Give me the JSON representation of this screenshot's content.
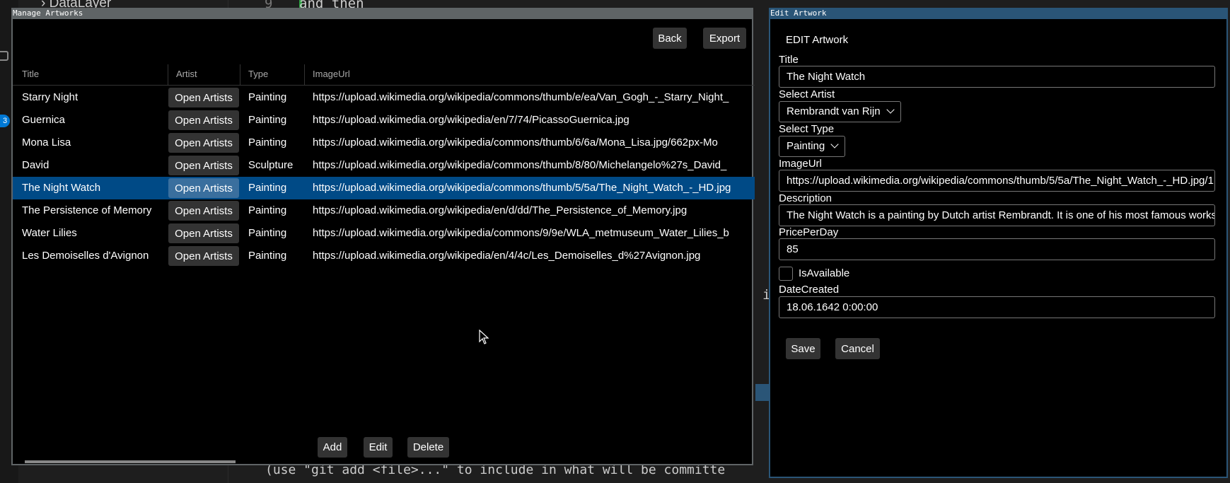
{
  "ide": {
    "explorer_item": "DataLayer",
    "line_number": "9",
    "code_text": "and then",
    "stray_char": "i",
    "terminal_text": "(use \"git add <file>...\" to include in what will be committe",
    "badge": "3"
  },
  "manage": {
    "window_title": "Manage Artworks",
    "back_label": "Back",
    "export_label": "Export",
    "columns": [
      "Title",
      "Artist",
      "Type",
      "ImageUrl"
    ],
    "open_artists_label": "Open Artists",
    "rows": [
      {
        "title": "Starry Night",
        "type": "Painting",
        "url": "https://upload.wikimedia.org/wikipedia/commons/thumb/e/ea/Van_Gogh_-_Starry_Night_"
      },
      {
        "title": "Guernica",
        "type": "Painting",
        "url": "https://upload.wikimedia.org/wikipedia/en/7/74/PicassoGuernica.jpg"
      },
      {
        "title": "Mona Lisa",
        "type": "Painting",
        "url": "https://upload.wikimedia.org/wikipedia/commons/thumb/6/6a/Mona_Lisa.jpg/662px-Mo"
      },
      {
        "title": "David",
        "type": "Sculpture",
        "url": "https://upload.wikimedia.org/wikipedia/commons/thumb/8/80/Michelangelo%27s_David_"
      },
      {
        "title": "The Night Watch",
        "type": "Painting",
        "url": "https://upload.wikimedia.org/wikipedia/commons/thumb/5/5a/The_Night_Watch_-_HD.jpg",
        "selected": true
      },
      {
        "title": "The Persistence of Memory",
        "type": "Painting",
        "url": "https://upload.wikimedia.org/wikipedia/en/d/dd/The_Persistence_of_Memory.jpg"
      },
      {
        "title": "Water Lilies",
        "type": "Painting",
        "url": "https://upload.wikimedia.org/wikipedia/commons/9/9e/WLA_metmuseum_Water_Lilies_b"
      },
      {
        "title": "Les Demoiselles d'Avignon",
        "type": "Painting",
        "url": "https://upload.wikimedia.org/wikipedia/en/4/4c/Les_Demoiselles_d%27Avignon.jpg"
      }
    ],
    "add_label": "Add",
    "edit_label": "Edit",
    "delete_label": "Delete"
  },
  "edit": {
    "window_title": "Edit Artwork",
    "heading": "EDIT Artwork",
    "title_label": "Title",
    "title_value": "The Night Watch",
    "artist_label": "Select Artist",
    "artist_value": "Rembrandt van Rijn",
    "type_label": "Select Type",
    "type_value": "Painting",
    "imageurl_label": "ImageUrl",
    "imageurl_value": "https://upload.wikimedia.org/wikipedia/commons/thumb/5/5a/The_Night_Watch_-_HD.jpg/1",
    "description_label": "Description",
    "description_value": "The Night Watch is a painting by Dutch artist Rembrandt. It is one of his most famous works.",
    "price_label": "PricePerDay",
    "price_value": "85",
    "available_label": "IsAvailable",
    "available_checked": false,
    "date_label": "DateCreated",
    "date_value": "18.06.1642 0:00:00",
    "save_label": "Save",
    "cancel_label": "Cancel"
  },
  "colors": {
    "selection": "#004a86",
    "edit_titlebar": "#2a5577",
    "manage_titlebar": "#5f6466"
  }
}
